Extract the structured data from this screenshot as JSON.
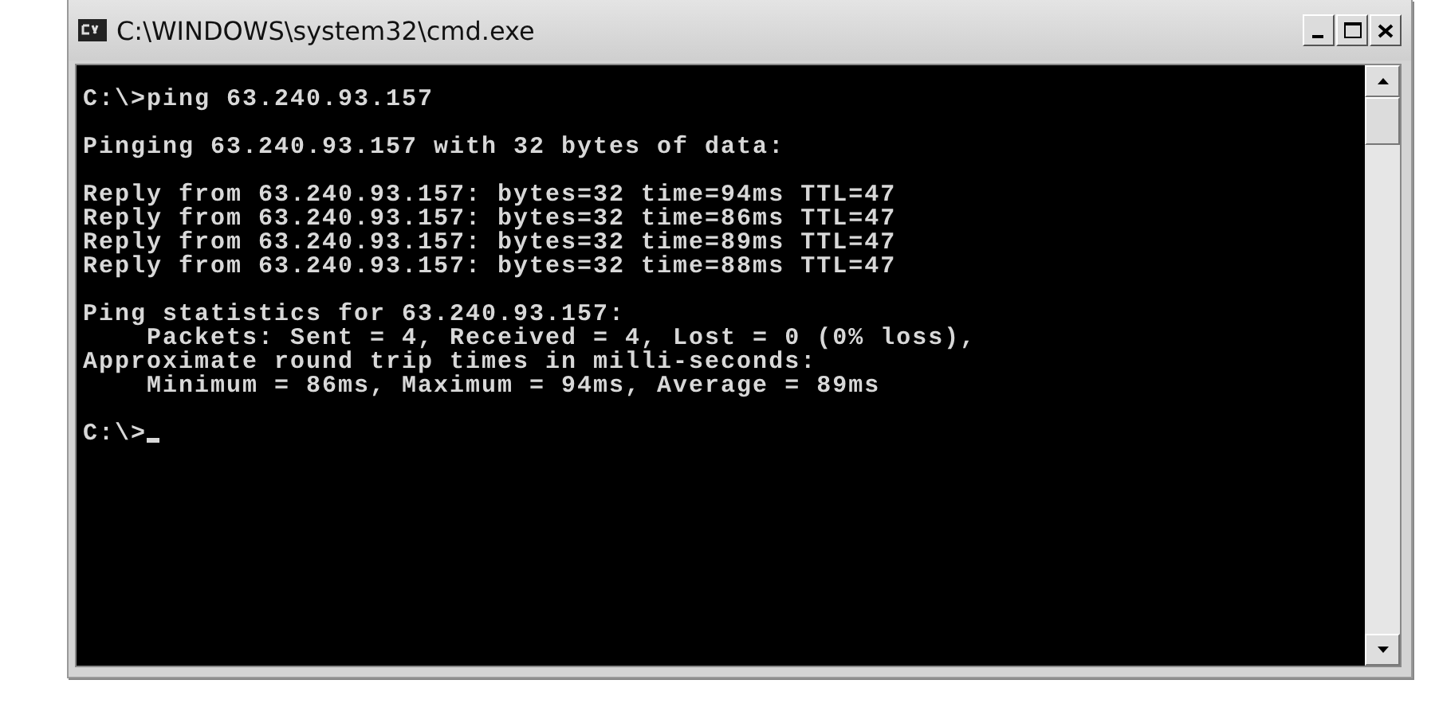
{
  "window": {
    "title": "C:\\WINDOWS\\system32\\cmd.exe"
  },
  "console": {
    "blocks": [
      [
        "C:\\>ping 63.240.93.157"
      ],
      [
        "Pinging 63.240.93.157 with 32 bytes of data:"
      ],
      [
        "Reply from 63.240.93.157: bytes=32 time=94ms TTL=47",
        "Reply from 63.240.93.157: bytes=32 time=86ms TTL=47",
        "Reply from 63.240.93.157: bytes=32 time=89ms TTL=47",
        "Reply from 63.240.93.157: bytes=32 time=88ms TTL=47"
      ],
      [
        "Ping statistics for 63.240.93.157:",
        "    Packets: Sent = 4, Received = 4, Lost = 0 (0% loss),",
        "Approximate round trip times in milli-seconds:",
        "    Minimum = 86ms, Maximum = 94ms, Average = 89ms"
      ]
    ],
    "prompt": "C:\\>"
  }
}
